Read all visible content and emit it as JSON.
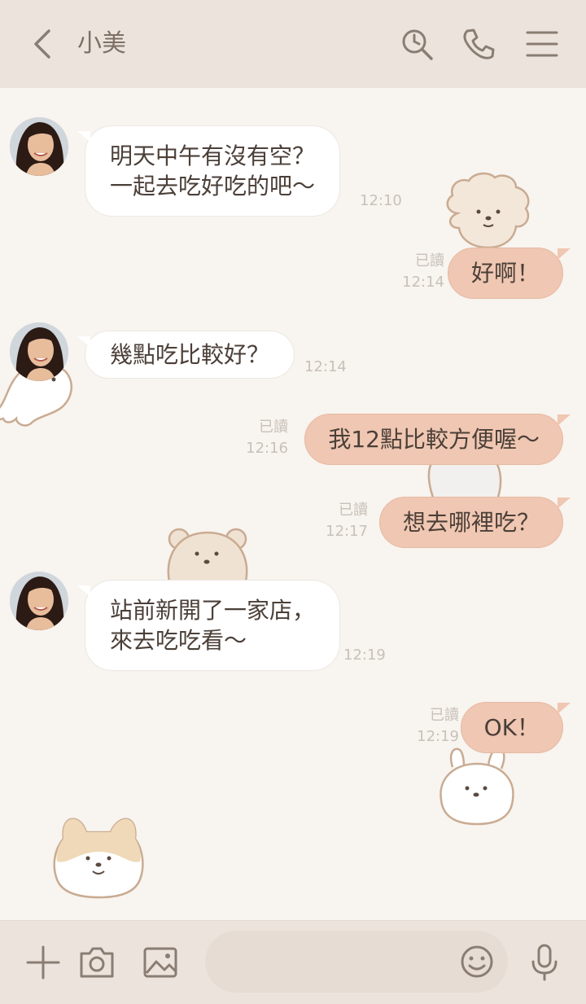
{
  "header": {
    "title": "小美",
    "icons": [
      "back-icon",
      "search-icon",
      "phone-icon",
      "menu-icon"
    ]
  },
  "messages": [
    {
      "side": "in",
      "text": "明天中午有沒有空？\n一起去吃好吃的吧～",
      "time": "12:10"
    },
    {
      "side": "out",
      "text": "好啊！",
      "read": "已讀",
      "time": "12:14"
    },
    {
      "side": "in",
      "text": "幾點吃比較好？",
      "time": "12:14"
    },
    {
      "side": "out",
      "text": "我12點比較方便喔～",
      "read": "已讀",
      "time": "12:16"
    },
    {
      "side": "out",
      "text": "想去哪裡吃？",
      "read": "已讀",
      "time": "12:17"
    },
    {
      "side": "in",
      "text": "站前新開了一家店，\n來去吃吃看～",
      "time": "12:19"
    },
    {
      "side": "out",
      "text": "OK！",
      "read": "已讀",
      "time": "12:19"
    }
  ],
  "footer": {
    "input_placeholder": "",
    "icons": [
      "plus-icon",
      "camera-icon",
      "image-icon",
      "smile-icon",
      "mic-icon"
    ]
  },
  "colors": {
    "header_bg": "#ece4dc",
    "chat_bg": "#f8f4ef",
    "out_bubble": "#efc7b2",
    "in_bubble": "#ffffff"
  }
}
